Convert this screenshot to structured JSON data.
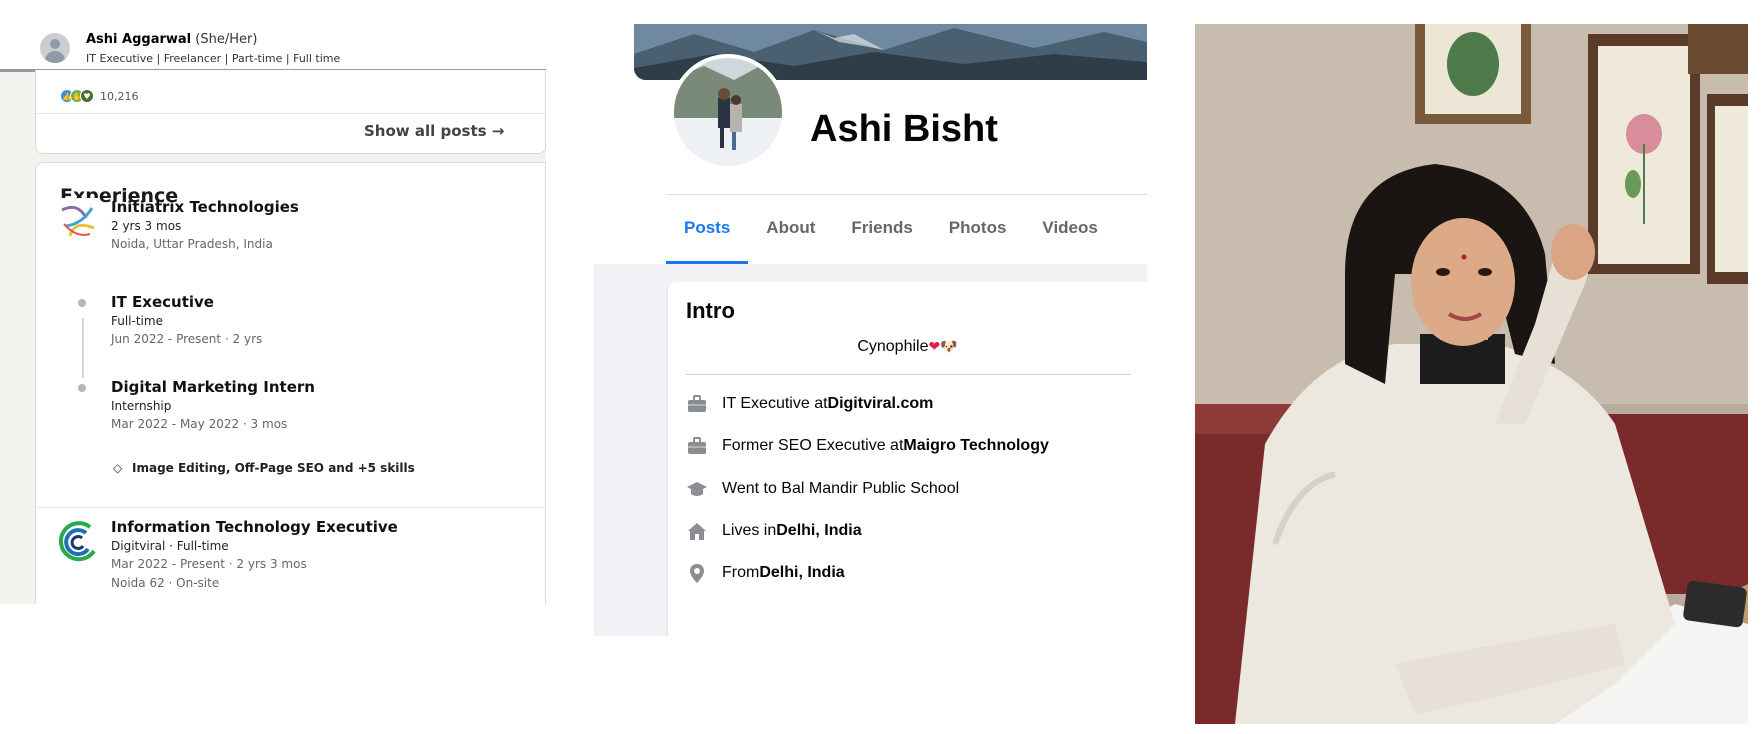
{
  "linkedin": {
    "profile": {
      "name": "Ashi Aggarwal",
      "pronouns": "(She/Her)",
      "headline": "IT Executive | Freelancer | Part-time | Full time"
    },
    "posts": {
      "reaction_count": "10,216",
      "show_all_label": "Show all posts →"
    },
    "experience": {
      "title": "Experience",
      "companies": [
        {
          "name": "Initiatrix Technologies",
          "duration": "2 yrs 3 mos",
          "location": "Noida, Uttar Pradesh, India",
          "roles": [
            {
              "title": "IT Executive",
              "type": "Full-time",
              "dates": "Jun 2022 - Present · 2 yrs"
            },
            {
              "title": "Digital Marketing Intern",
              "type": "Internship",
              "dates": "Mar 2022 - May 2022 · 3 mos",
              "skills": "Image Editing, Off-Page SEO and +5 skills"
            }
          ]
        },
        {
          "name": "Information Technology Executive",
          "company_line": "Digitviral · Full-time",
          "dates": "Mar 2022 - Present · 2 yrs 3 mos",
          "location": "Noida 62 · On-site"
        }
      ]
    }
  },
  "facebook": {
    "name": "Ashi Bisht",
    "tabs": [
      "Posts",
      "About",
      "Friends",
      "Photos",
      "Videos"
    ],
    "active_tab": "Posts",
    "intro": {
      "title": "Intro",
      "bio": "Cynophile",
      "rows": [
        {
          "icon": "briefcase-icon",
          "prefix": "IT Executive at ",
          "bold": "Digitviral.com"
        },
        {
          "icon": "briefcase-icon",
          "prefix": "Former SEO Executive at ",
          "bold": "Maigro Technology"
        },
        {
          "icon": "graduation-cap-icon",
          "prefix": "Went to Bal Mandir Public School",
          "bold": ""
        },
        {
          "icon": "home-icon",
          "prefix": "Lives in ",
          "bold": "Delhi, India"
        },
        {
          "icon": "location-pin-icon",
          "prefix": "From ",
          "bold": "Delhi, India"
        }
      ]
    }
  },
  "colors": {
    "fb_blue": "#1877f2",
    "linkedin_bg": "#f4f2ee",
    "fb_bg": "#f0f2f5"
  }
}
